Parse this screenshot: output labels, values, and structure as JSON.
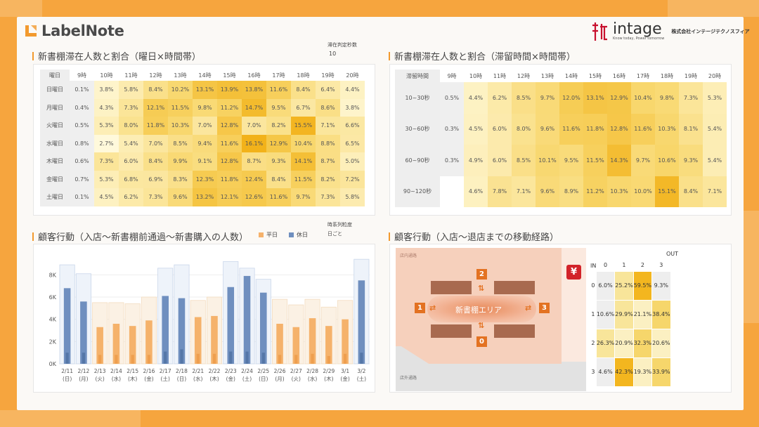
{
  "logo": {
    "text": "LabelNote"
  },
  "brand": {
    "name": "intage",
    "tagline": "Know today, Power tomorrow",
    "company": "株式会社インテージテクノスフィア"
  },
  "colors": {
    "accent": "#f29a2e",
    "weekday": "#f5b26b",
    "holiday": "#6f8fbf"
  },
  "filter": {
    "label": "滞在判定秒数",
    "value": "10"
  },
  "heat1": {
    "title": "新書棚滞在人数と割合（曜日×時間帯）",
    "corner": "曜日",
    "cols": [
      "9時",
      "10時",
      "11時",
      "12時",
      "13時",
      "14時",
      "15時",
      "16時",
      "17時",
      "18時",
      "19時",
      "20時"
    ],
    "rows": [
      {
        "label": "日曜日",
        "values": [
          "0.1%",
          "3.8%",
          "5.8%",
          "8.4%",
          "10.2%",
          "13.1%",
          "13.9%",
          "13.8%",
          "11.6%",
          "8.4%",
          "6.4%",
          "4.4%"
        ]
      },
      {
        "label": "月曜日",
        "values": [
          "0.4%",
          "4.3%",
          "7.3%",
          "12.1%",
          "11.5%",
          "9.8%",
          "11.2%",
          "14.7%",
          "9.5%",
          "6.7%",
          "8.6%",
          "3.8%"
        ]
      },
      {
        "label": "火曜日",
        "values": [
          "0.5%",
          "5.3%",
          "8.0%",
          "11.8%",
          "10.3%",
          "7.0%",
          "12.8%",
          "7.0%",
          "8.2%",
          "15.5%",
          "7.1%",
          "6.6%"
        ]
      },
      {
        "label": "水曜日",
        "values": [
          "0.8%",
          "2.7%",
          "5.4%",
          "7.0%",
          "8.5%",
          "9.4%",
          "11.6%",
          "16.1%",
          "12.9%",
          "10.4%",
          "8.8%",
          "6.5%"
        ]
      },
      {
        "label": "木曜日",
        "values": [
          "0.6%",
          "7.3%",
          "6.0%",
          "8.4%",
          "9.9%",
          "9.1%",
          "12.8%",
          "8.7%",
          "9.3%",
          "14.1%",
          "8.7%",
          "5.0%"
        ]
      },
      {
        "label": "金曜日",
        "values": [
          "0.7%",
          "5.3%",
          "6.8%",
          "6.9%",
          "8.3%",
          "12.3%",
          "11.8%",
          "12.4%",
          "8.4%",
          "11.5%",
          "8.2%",
          "7.2%"
        ]
      },
      {
        "label": "土曜日",
        "values": [
          "0.1%",
          "4.5%",
          "6.2%",
          "7.3%",
          "9.6%",
          "13.2%",
          "12.1%",
          "12.6%",
          "11.6%",
          "9.7%",
          "7.3%",
          "5.8%"
        ]
      }
    ]
  },
  "heat2": {
    "title": "新書棚滞在人数と割合（滞留時間×時間帯）",
    "corner": "滞留時間",
    "cols": [
      "9時",
      "10時",
      "11時",
      "12時",
      "13時",
      "14時",
      "15時",
      "16時",
      "17時",
      "18時",
      "19時",
      "20時"
    ],
    "rows": [
      {
        "label": "10~30秒",
        "values": [
          "0.5%",
          "4.4%",
          "6.2%",
          "8.5%",
          "9.7%",
          "12.0%",
          "13.1%",
          "12.9%",
          "10.4%",
          "9.8%",
          "7.3%",
          "5.3%"
        ]
      },
      {
        "label": "30~60秒",
        "values": [
          "0.3%",
          "4.5%",
          "6.0%",
          "8.0%",
          "9.6%",
          "11.6%",
          "11.8%",
          "12.8%",
          "11.6%",
          "10.3%",
          "8.1%",
          "5.4%"
        ]
      },
      {
        "label": "60~90秒",
        "values": [
          "0.3%",
          "4.9%",
          "6.0%",
          "8.5%",
          "10.1%",
          "9.5%",
          "11.5%",
          "14.3%",
          "9.7%",
          "10.6%",
          "9.3%",
          "5.4%"
        ]
      },
      {
        "label": "90~120秒",
        "values": [
          "",
          "4.6%",
          "7.8%",
          "7.1%",
          "9.6%",
          "8.9%",
          "11.2%",
          "10.3%",
          "10.0%",
          "15.1%",
          "8.4%",
          "7.1%"
        ]
      }
    ]
  },
  "behavior": {
    "title": "顧客行動（入店～新書棚前通過～新書購入の人数）",
    "legend_weekday": "平日",
    "legend_holiday": "休日",
    "granularity_label": "時系列粒度",
    "granularity_value": "日ごと"
  },
  "route": {
    "title": "顧客行動（入店～退店までの移動経路）",
    "label_in_store": "店内通路",
    "label_out_store": "店外通路",
    "area_label": "新書棚エリア",
    "register_icon": "¥",
    "nodes": [
      "2",
      "1",
      "3",
      "0"
    ],
    "matrix": {
      "out_label": "OUT",
      "in_label": "IN",
      "cols": [
        "0",
        "1",
        "2",
        "3"
      ],
      "rows": [
        {
          "label": "0",
          "values": [
            "6.0%",
            "25.2%",
            "59.5%",
            "9.3%"
          ]
        },
        {
          "label": "1",
          "values": [
            "10.6%",
            "29.9%",
            "21.1%",
            "38.4%"
          ]
        },
        {
          "label": "2",
          "values": [
            "26.3%",
            "20.9%",
            "32.3%",
            "20.6%"
          ]
        },
        {
          "label": "3",
          "values": [
            "4.6%",
            "42.3%",
            "19.3%",
            "33.9%"
          ]
        }
      ]
    }
  },
  "chart_data": {
    "type": "bar",
    "title": "顧客行動（入店～新書棚前通過～新書購入の人数）",
    "categories": [
      "2/11\n(日)",
      "2/12\n(月)",
      "2/13\n(火)",
      "2/14\n(水)",
      "2/15\n(木)",
      "2/16\n(金)",
      "2/17\n(土)",
      "2/18\n(日)",
      "2/21\n(水)",
      "2/22\n(木)",
      "2/23\n(金)",
      "2/24\n(土)",
      "2/25\n(日)",
      "2/26\n(月)",
      "2/27\n(火)",
      "2/28\n(水)",
      "2/29\n(木)",
      "3/1\n(金)",
      "3/2\n(土)"
    ],
    "day_type": [
      "holiday",
      "holiday",
      "weekday",
      "weekday",
      "weekday",
      "weekday",
      "holiday",
      "holiday",
      "weekday",
      "weekday",
      "holiday",
      "holiday",
      "holiday",
      "weekday",
      "weekday",
      "weekday",
      "weekday",
      "weekday",
      "holiday"
    ],
    "series": [
      {
        "name": "入店",
        "values": [
          8900,
          8100,
          5500,
          5500,
          5400,
          6000,
          8600,
          8900,
          5700,
          6000,
          9200,
          8600,
          7600,
          5800,
          5300,
          5800,
          5100,
          5700,
          9400
        ]
      },
      {
        "name": "新書棚前通過",
        "values": [
          6800,
          5600,
          3300,
          3600,
          3400,
          3900,
          6100,
          5900,
          4200,
          4300,
          6900,
          7900,
          6400,
          3600,
          3300,
          4100,
          3400,
          4000,
          7500
        ]
      },
      {
        "name": "新書購入",
        "values": [
          1000,
          1000,
          800,
          800,
          800,
          800,
          1100,
          1300,
          900,
          900,
          1100,
          1100,
          1000,
          800,
          800,
          900,
          700,
          900,
          1000
        ]
      }
    ],
    "y_ticks": [
      "0K",
      "2K",
      "4K",
      "6K",
      "8K"
    ],
    "ylim": [
      0,
      9600
    ],
    "legend": [
      "平日",
      "休日"
    ]
  }
}
